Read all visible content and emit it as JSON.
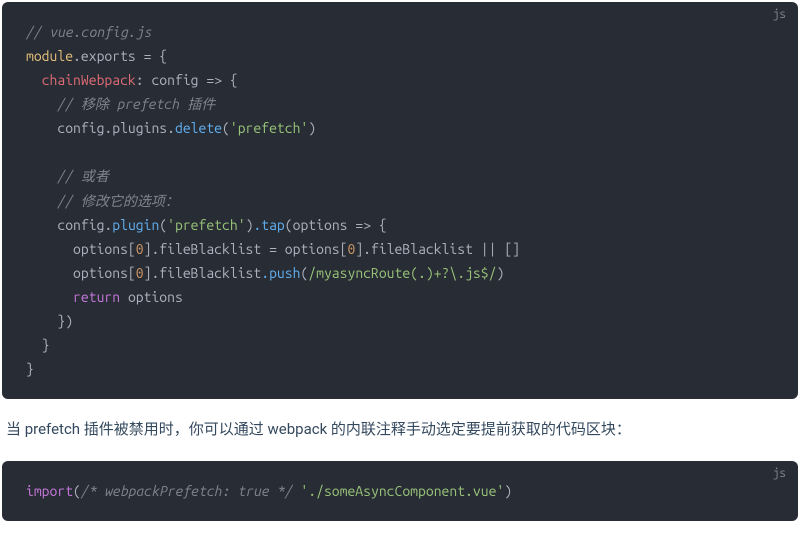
{
  "block1": {
    "lang": "js",
    "c_file": "// vue.config.js",
    "module": "module",
    "exports": ".exports",
    "eq_open": " = {",
    "chainWebpack": "chainWebpack",
    "colon": ": ",
    "config": "config",
    "arrow_open": " => {",
    "c_remove": "// 移除 prefetch 插件",
    "cfg_plugins": "config.plugins.",
    "delete": "delete",
    "prefetch_str": "'prefetch'",
    "c_or": "// 或者",
    "c_modify": "// 修改它的选项：",
    "cfg_plugin": "config.",
    "plugin": "plugin",
    "tap": ".tap",
    "options": "options",
    "line_ob0": "options[",
    "zero": "0",
    "rb": "].fileBlacklist",
    "assign_eq": " = ",
    "or_empty": " || []",
    "push": ".push",
    "regex": "/myasyncRoute(.)+?\\.js$/",
    "return": "return",
    "close_paren_brace": "})",
    "close_brace": "}"
  },
  "body_text": "当 prefetch 插件被禁用时，你可以通过 webpack 的内联注释手动选定要提前获取的代码区块：",
  "block2": {
    "lang": "js",
    "import": "import",
    "open": "(",
    "comment": "/* webpackPrefetch: true */",
    "space": " ",
    "path": "'./someAsyncComponent.vue'",
    "close": ")"
  }
}
